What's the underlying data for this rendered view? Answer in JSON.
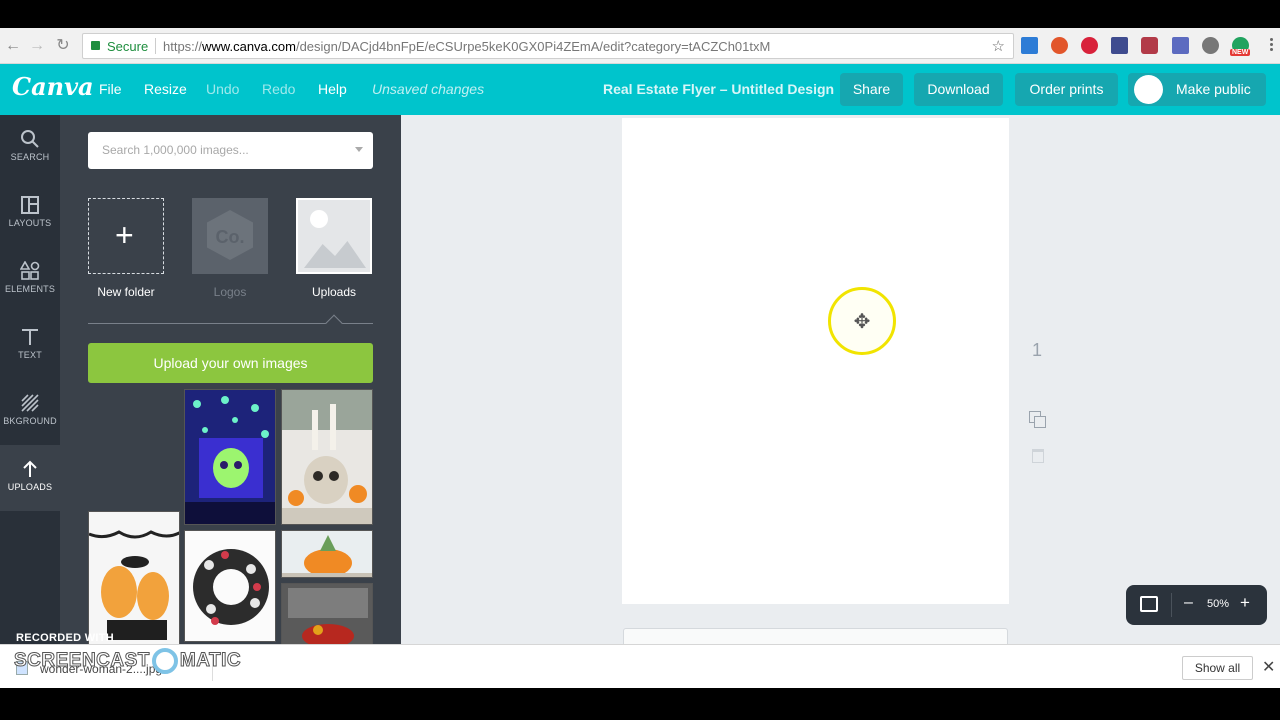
{
  "browser": {
    "secure_label": "Secure",
    "url_scheme": "https://",
    "url_host": "www.canva.com",
    "url_path": "/design/DACjd4bnFpE/eCSUrpe5keK0GX0Pi4ZEmA/edit?category=tACZCh01txM",
    "extension_badge": "NEW"
  },
  "header": {
    "logo": "Canva",
    "menu": {
      "file": "File",
      "resize": "Resize",
      "undo": "Undo",
      "redo": "Redo",
      "help": "Help"
    },
    "status": "Unsaved changes",
    "doc_title": "Real Estate Flyer – Untitled Design",
    "buttons": {
      "share": "Share",
      "download": "Download",
      "order_prints": "Order prints",
      "make_public": "Make public"
    }
  },
  "rail": {
    "items": [
      {
        "label": "SEARCH",
        "icon": "search-icon"
      },
      {
        "label": "LAYOUTS",
        "icon": "layouts-icon"
      },
      {
        "label": "ELEMENTS",
        "icon": "elements-icon"
      },
      {
        "label": "TEXT",
        "icon": "text-icon"
      },
      {
        "label": "BKGROUND",
        "icon": "background-icon"
      },
      {
        "label": "UPLOADS",
        "icon": "upload-arrow-icon"
      }
    ],
    "active": "UPLOADS"
  },
  "panel": {
    "search_placeholder": "Search 1,000,000 images...",
    "tiles": {
      "new_folder": "New folder",
      "logos": "Logos",
      "logos_mark": "Co.",
      "uploads": "Uploads"
    },
    "upload_button": "Upload your own images"
  },
  "canvas": {
    "page_number": "1",
    "zoom": "50%"
  },
  "watermark": {
    "recorded_with": "RECORDED WITH",
    "brand_left": "SCREENCAST",
    "brand_right": "MATIC"
  },
  "downloads": {
    "filename": "wonder-woman-2....jpg",
    "show_all": "Show all"
  },
  "colors": {
    "header": "#00c4cc",
    "rail": "#293039",
    "panel": "#3a414a",
    "upload_button": "#8cc63f",
    "workspace": "#eaedf0"
  }
}
